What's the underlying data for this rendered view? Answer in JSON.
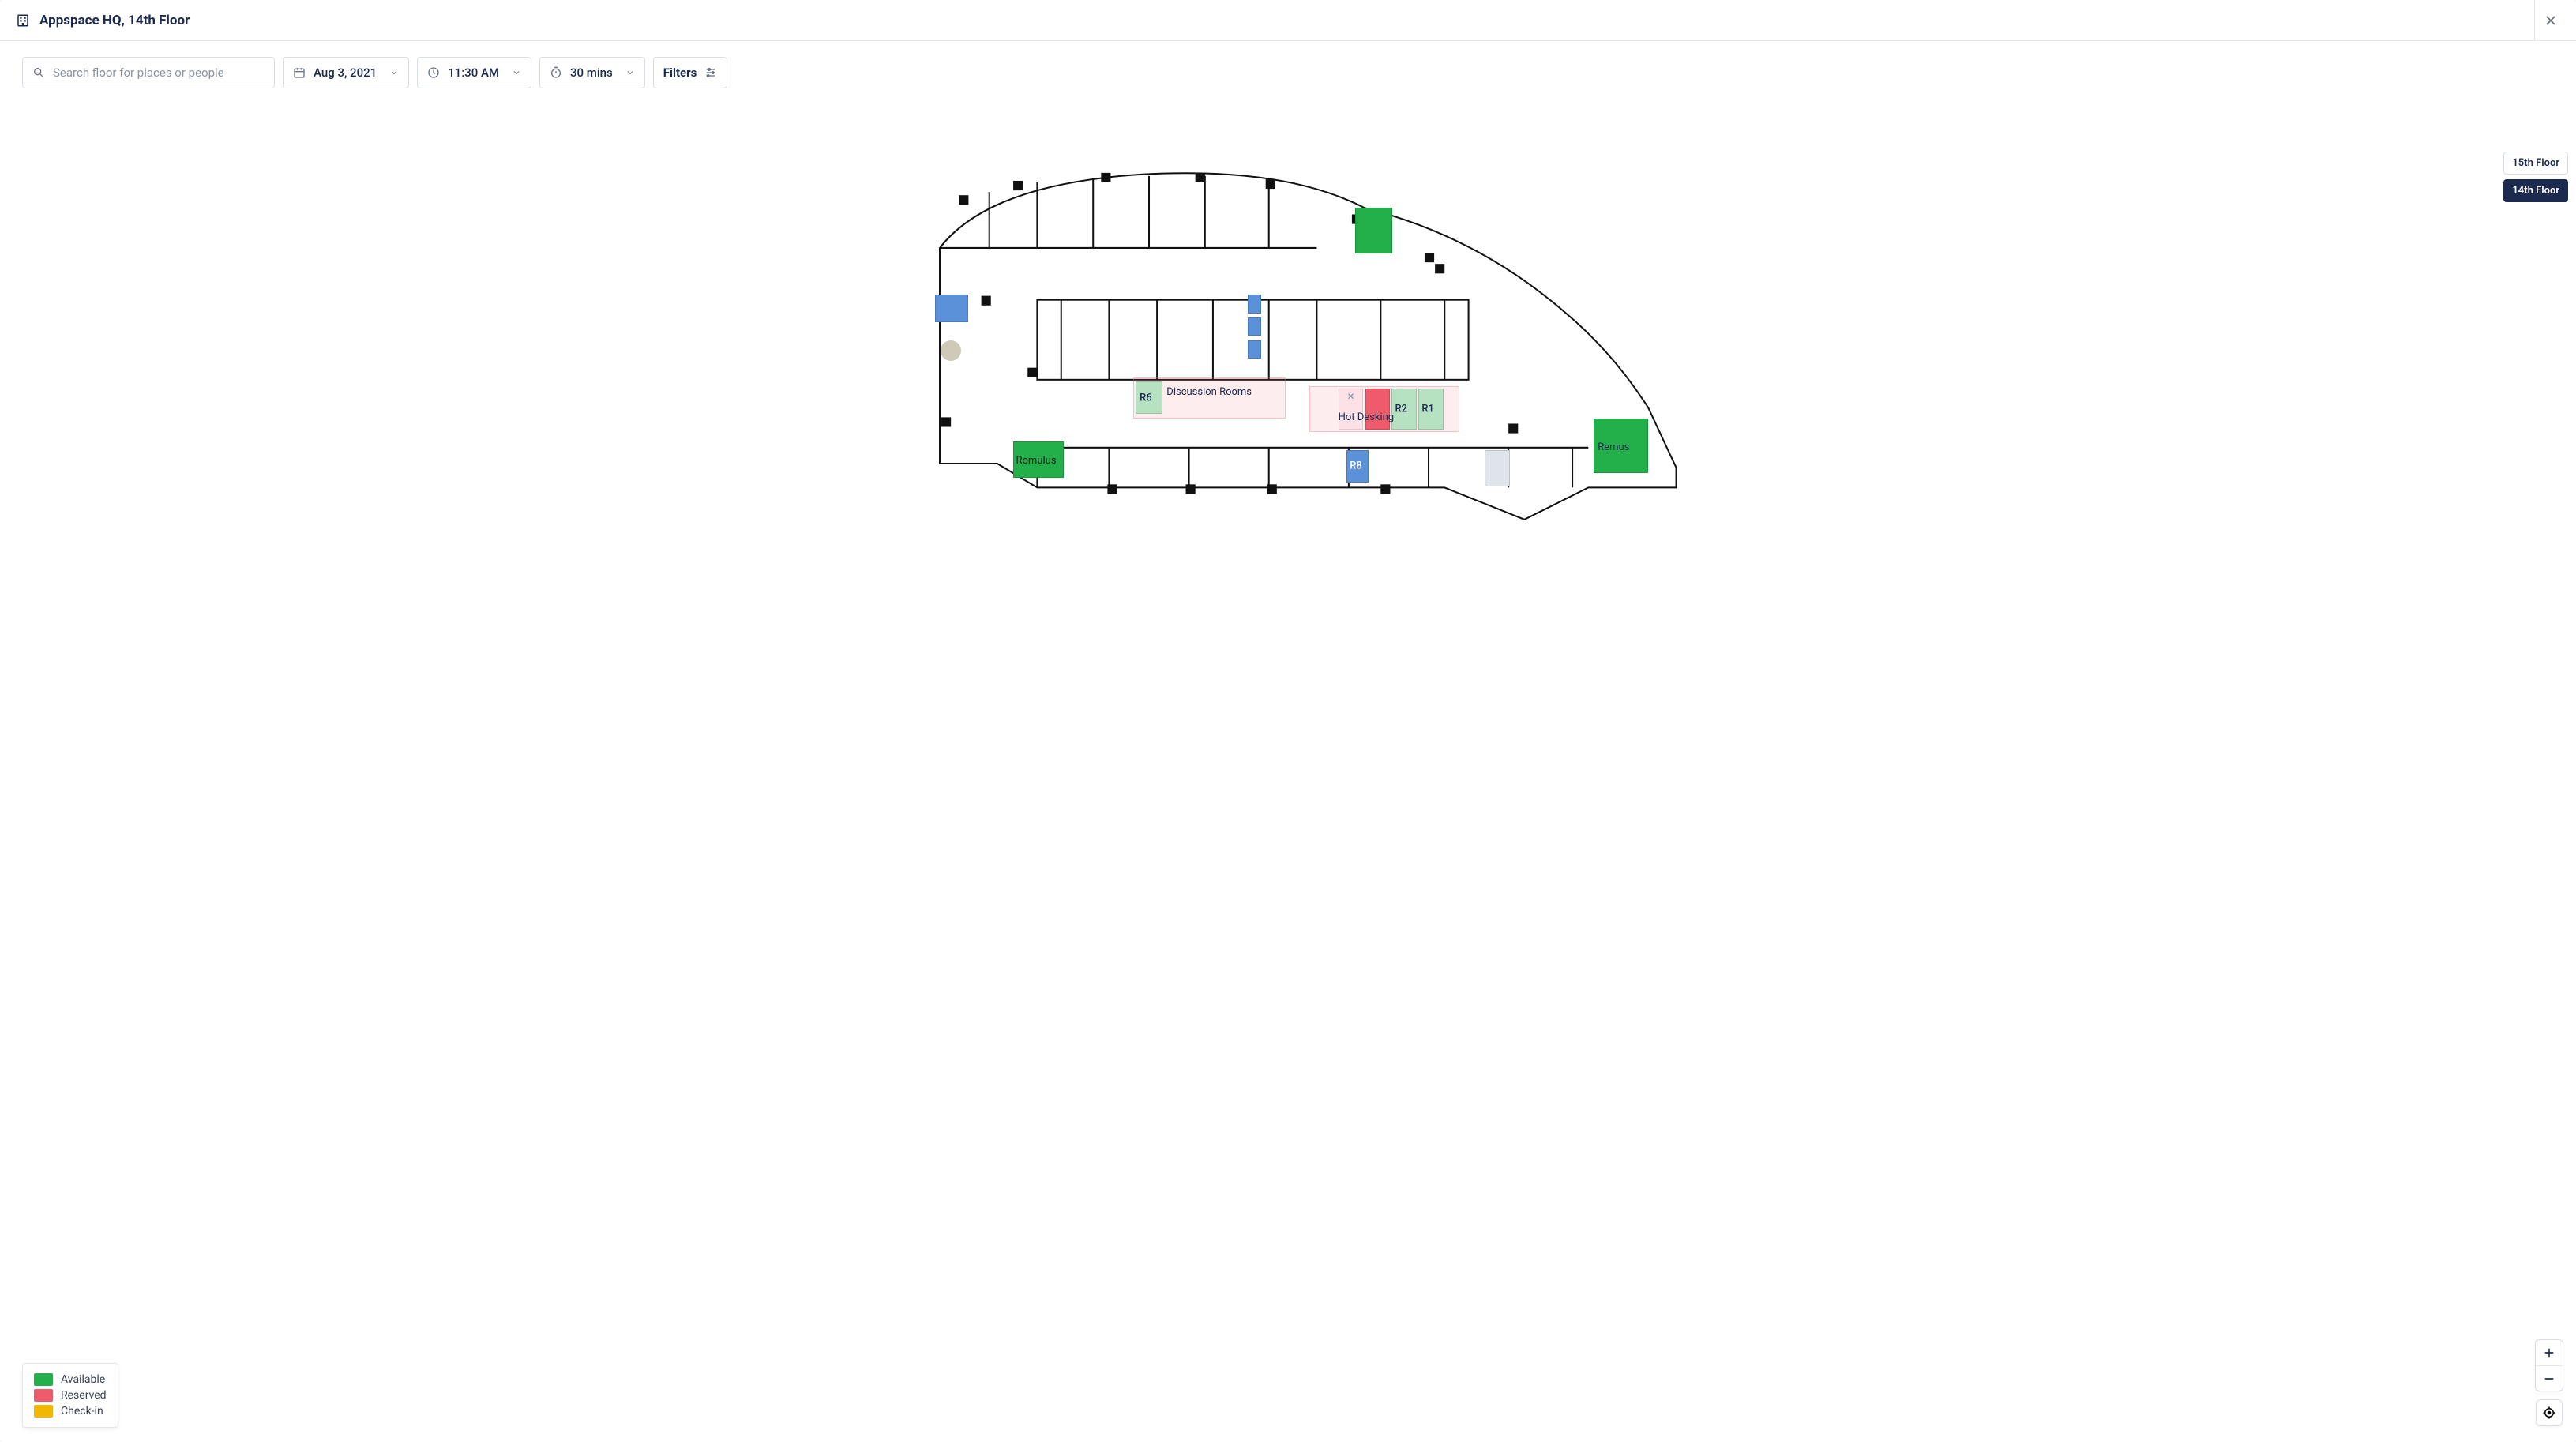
{
  "header": {
    "title": "Appspace HQ, 14th Floor"
  },
  "toolbar": {
    "search_placeholder": "Search floor for places or people",
    "date": "Aug 3, 2021",
    "time": "11:30 AM",
    "duration": "30 mins",
    "filters_label": "Filters"
  },
  "floor_selector": {
    "floors": [
      {
        "label": "15th Floor",
        "active": false
      },
      {
        "label": "14th Floor",
        "active": true
      }
    ]
  },
  "legend": {
    "items": [
      {
        "label": "Available",
        "color": "green"
      },
      {
        "label": "Reserved",
        "color": "red"
      },
      {
        "label": "Check-in",
        "color": "yellow"
      }
    ]
  },
  "map": {
    "area_labels": {
      "discussion_rooms": "Discussion Rooms",
      "hot_desking": "Hot Desking"
    },
    "rooms": {
      "romulus": "Romulus",
      "remus": "Remus",
      "r1": "R1",
      "r2": "R2",
      "r6": "R6",
      "r8": "R8"
    }
  }
}
